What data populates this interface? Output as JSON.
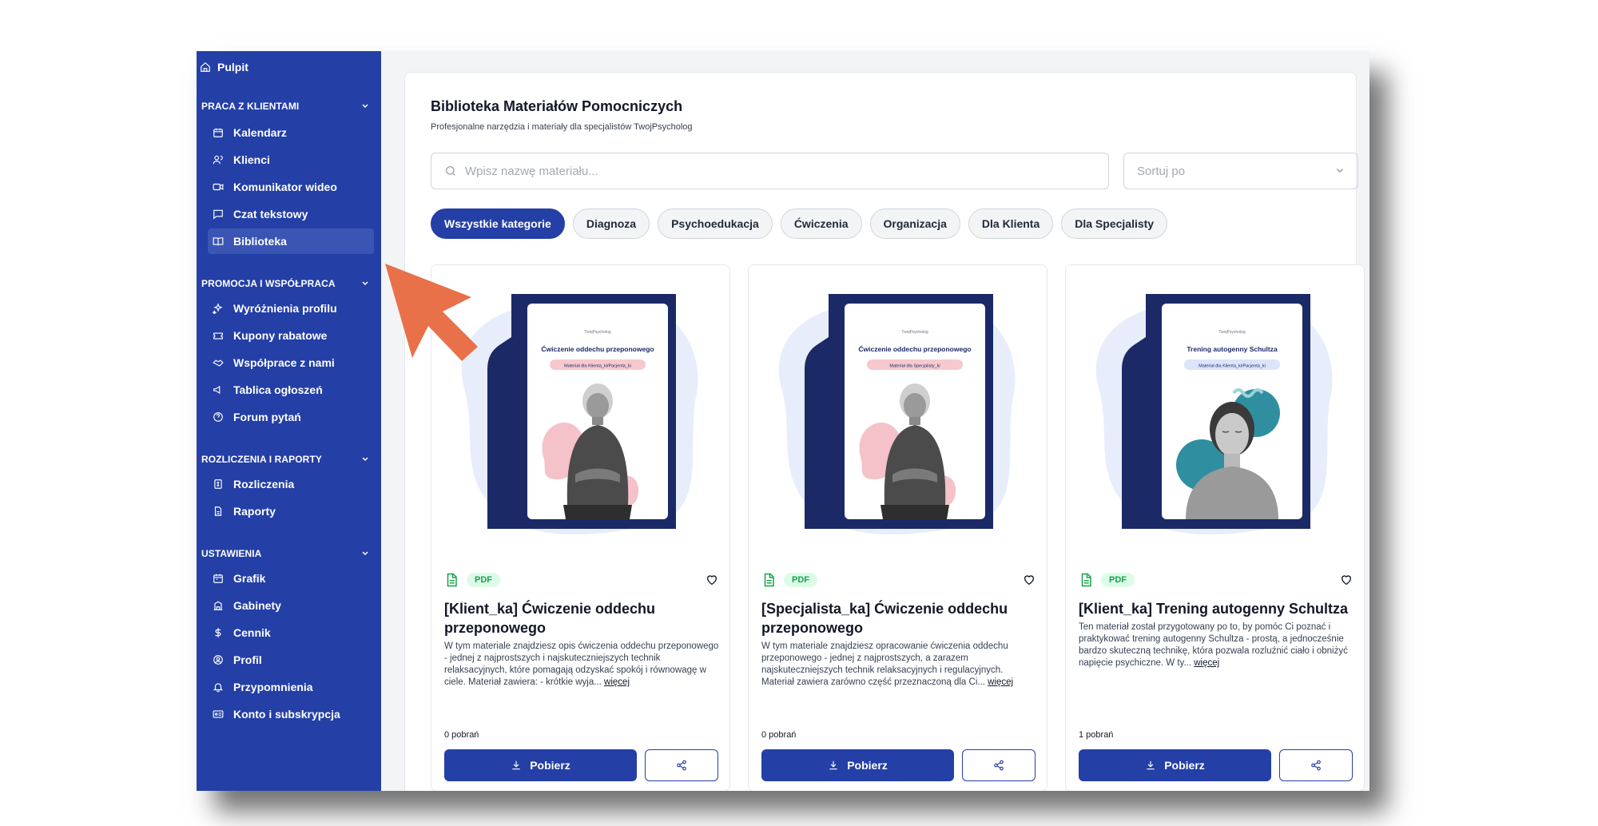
{
  "sidebar": {
    "top_item": "Pulpit",
    "sections": [
      {
        "title": "PRACA Z KLIENTAMI",
        "items": [
          {
            "label": "Kalendarz",
            "icon": "calendar-icon"
          },
          {
            "label": "Klienci",
            "icon": "users-icon"
          },
          {
            "label": "Komunikator wideo",
            "icon": "video-icon"
          },
          {
            "label": "Czat tekstowy",
            "icon": "chat-icon"
          },
          {
            "label": "Biblioteka",
            "icon": "book-icon",
            "active": true
          }
        ]
      },
      {
        "title": "PROMOCJA I WSPÓŁPRACA",
        "items": [
          {
            "label": "Wyróżnienia profilu",
            "icon": "sparkles-icon"
          },
          {
            "label": "Kupony rabatowe",
            "icon": "ticket-icon"
          },
          {
            "label": "Współprace z nami",
            "icon": "handshake-icon"
          },
          {
            "label": "Tablica ogłoszeń",
            "icon": "megaphone-icon"
          },
          {
            "label": "Forum pytań",
            "icon": "question-icon"
          }
        ]
      },
      {
        "title": "ROZLICZENIA I RAPORTY",
        "items": [
          {
            "label": "Rozliczenia",
            "icon": "receipt-icon"
          },
          {
            "label": "Raporty",
            "icon": "report-icon"
          }
        ]
      },
      {
        "title": "USTAWIENIA",
        "items": [
          {
            "label": "Grafik",
            "icon": "schedule-icon"
          },
          {
            "label": "Gabinety",
            "icon": "building-icon"
          },
          {
            "label": "Cennik",
            "icon": "dollar-icon"
          },
          {
            "label": "Profil",
            "icon": "profile-icon"
          },
          {
            "label": "Przypomnienia",
            "icon": "bell-icon"
          },
          {
            "label": "Konto i subskrypcja",
            "icon": "id-card-icon"
          }
        ]
      }
    ]
  },
  "main": {
    "title": "Biblioteka Materiałów Pomocniczych",
    "subtitle": "Profesjonalne narzędzia i materiały dla specjalistów TwojPsycholog",
    "search_placeholder": "Wpisz nazwę materiału...",
    "sort_placeholder": "Sortuj po",
    "categories": [
      "Wszystkie kategorie",
      "Diagnoza",
      "Psychoedukacja",
      "Ćwiczenia",
      "Organizacja",
      "Dla Klienta",
      "Dla Specjalisty"
    ],
    "active_category": "Wszystkie kategorie"
  },
  "cards": [
    {
      "type": "PDF",
      "title": "[Klient_ka] Ćwiczenie oddechu przeponowego",
      "description": "W tym materiale znajdziesz opis ćwiczenia oddechu przeponowego - jednej z najprostszych i najskuteczniejszych technik relaksacyjnych, które pomagają odzyskać spokój i równowagę w ciele. Materiał zawiera: - krótkie wyja...",
      "more": "więcej",
      "downloads": "0 pobrań",
      "download_label": "Pobierz",
      "doc_brand": "TwojPsycholog",
      "doc_title": "Ćwiczenie oddechu przeponowego",
      "doc_tag": "Materiał dla Klienta_ki/Pacjenta_ki"
    },
    {
      "type": "PDF",
      "title": "[Specjalista_ka] Ćwiczenie oddechu przeponowego",
      "description": "W tym materiale znajdziesz opracowanie ćwiczenia oddechu przeponowego - jednej z najprostszych, a zarazem najskuteczniejszych technik relaksacyjnych i regulacyjnych. Materiał zawiera zarówno część przeznaczoną dla Ci...",
      "more": "więcej",
      "downloads": "0 pobrań",
      "download_label": "Pobierz",
      "doc_brand": "TwojPsycholog",
      "doc_title": "Ćwiczenie oddechu przeponowego",
      "doc_tag": "Materiał dla Specjalisty_ki"
    },
    {
      "type": "PDF",
      "title": "[Klient_ka] Trening autogenny Schultza",
      "description": "Ten materiał został przygotowany po to, by pomóc Ci poznać i praktykować trening autogenny Schultza - prostą, a jednocześnie bardzo skuteczną technikę, która pozwala rozluźnić ciało i obniżyć napięcie psychiczne. W ty...",
      "more": "więcej",
      "downloads": "1 pobrań",
      "download_label": "Pobierz",
      "doc_brand": "TwojPsycholog",
      "doc_title": "Trening autogenny Schultza",
      "doc_tag": "Materiał dla Klienta_ki/Pacjenta_ki"
    }
  ],
  "colors": {
    "sidebar": "#243fa6",
    "accent": "#243fa6",
    "pointer_arrow": "#e8714a",
    "doc_frame": "#1b2a66",
    "pdf_badge": "#16a34a"
  }
}
